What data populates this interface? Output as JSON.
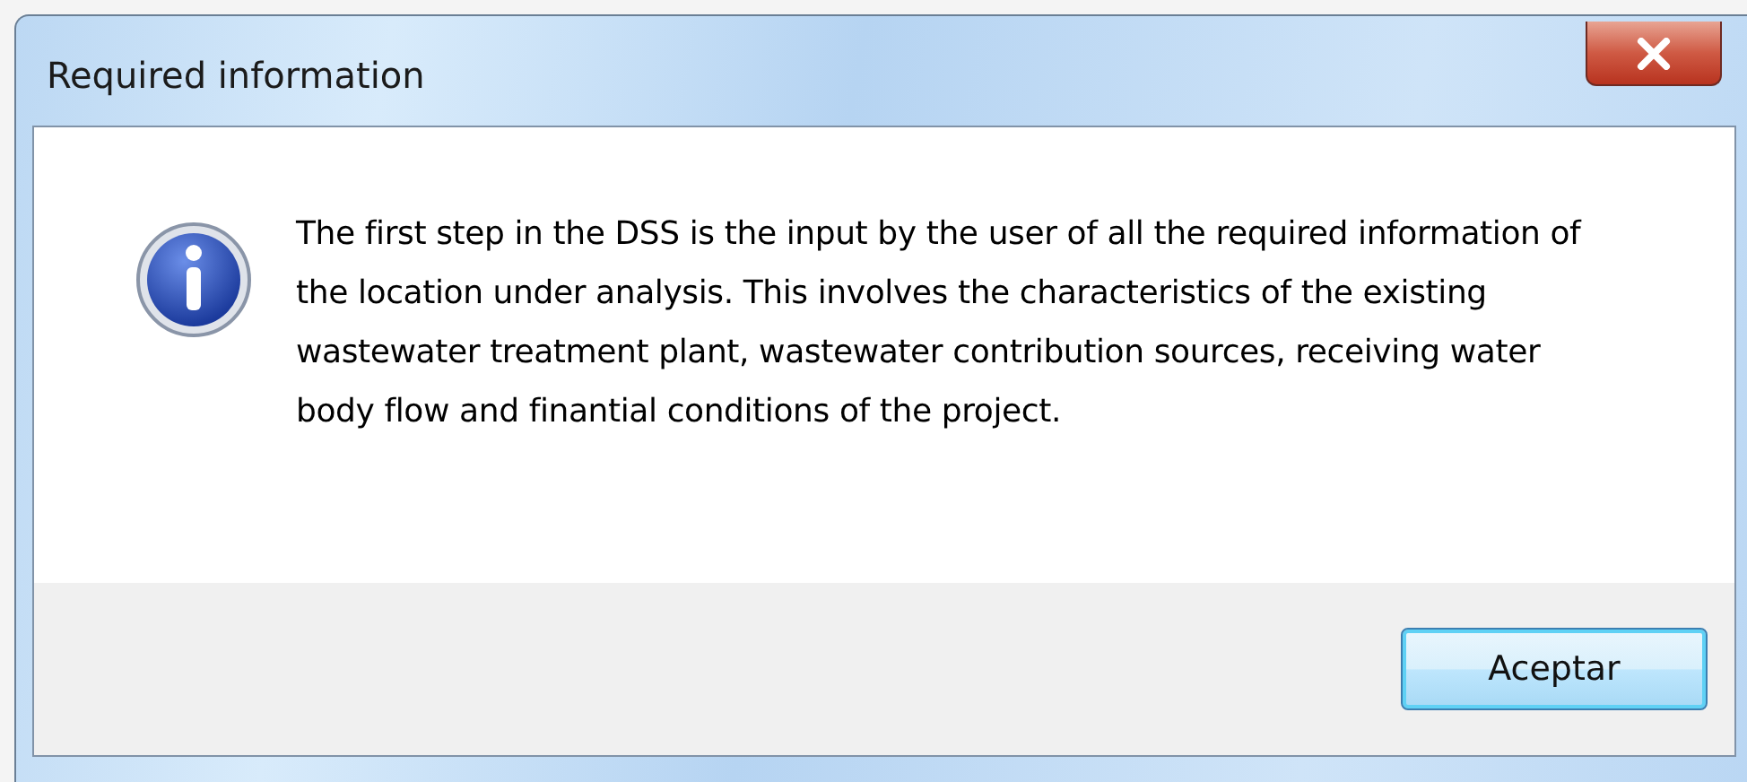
{
  "window": {
    "title": "Required information"
  },
  "message": "The first step in the DSS is the input by the user of all the required information of the location under analysis. This involves the characteristics of the existing wastewater treatment plant, wastewater contribution sources, receiving water body flow and finantial conditions of the project.",
  "buttons": [
    "Aceptar"
  ]
}
